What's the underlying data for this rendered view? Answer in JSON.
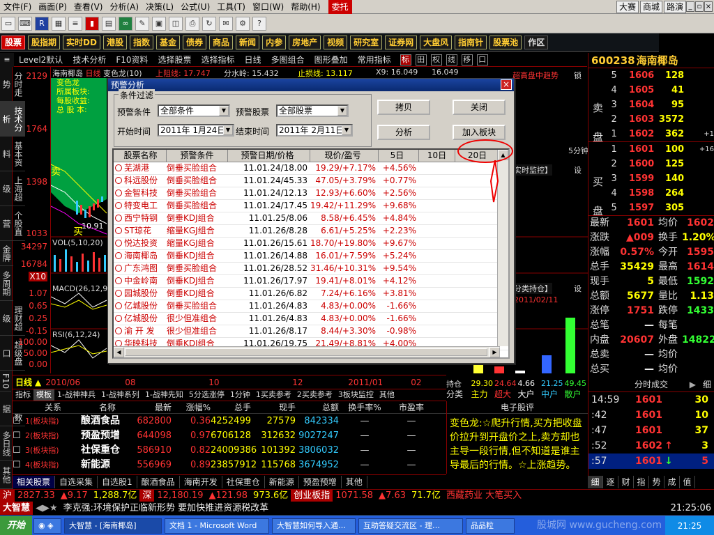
{
  "menubar": {
    "items": [
      "文件(F)",
      "画面(P)",
      "查看(V)",
      "分析(A)",
      "决策(L)",
      "公式(U)",
      "工具(T)",
      "窗口(W)",
      "帮助(H)"
    ],
    "trade": "委托",
    "right": [
      "大赛",
      "商城",
      "路演"
    ]
  },
  "tabs": [
    "股票",
    "股指期",
    "实时DD",
    "港股",
    "指数",
    "基金",
    "债券",
    "商品",
    "新闻",
    "内参",
    "房地产",
    "视频",
    "研究室",
    "证券网",
    "大盘风",
    "指南针",
    "股票池",
    "作区"
  ],
  "subbar": [
    "Level2默认",
    "技术分析",
    "F10资料",
    "选择股票",
    "选择指标",
    "日线",
    "多图组合",
    "图形叠加",
    "常用指标"
  ],
  "subbar_toggles": [
    "标",
    "田",
    "权",
    "线",
    "移",
    "口"
  ],
  "left_tabs": [
    "分时走势",
    "技术分析",
    "基本资料",
    "上海超级",
    "个股直营",
    "金牌",
    "多周期",
    "理财超级",
    "超级盘口",
    "F10",
    "主力数据",
    "多日线",
    "其他"
  ],
  "chart_header": {
    "stock": "海南椰岛",
    "period": "日线",
    "indicator": "变色龙(10)",
    "upper": "上阻线: 17.747",
    "mid": "分水岭: 15.432",
    "stop": "止损线: 13.117",
    "x9": "X9: 16.049",
    "x10": "16.049",
    "trend": "超高盘中趋势",
    "lock": "锁"
  },
  "chart_info": {
    "name": "变色龙",
    "sector_label": "所属板块:",
    "eps_label": "每股收益:",
    "share_label": "总 股 本:"
  },
  "price_axis": [
    "2129",
    "1764",
    "1398",
    "1033",
    "34297",
    "16784",
    "X10",
    "1.07",
    "0.65",
    "0.25",
    "-0.15",
    "100.00",
    "50.00",
    "0.00"
  ],
  "indicators": {
    "vol": "VOL(5,10,20)",
    "macd": "MACD(26,12,9)",
    "rsi": "RSI(6,12,24)"
  },
  "chart_labels": {
    "low": "10.91",
    "buy": "买",
    "sell": "卖",
    "realtime": "实时监控】",
    "set": "设",
    "classify": "分类持仓】",
    "set2": "设",
    "date": "2011/02/11",
    "fivemin": "5分钟"
  },
  "date_axis": {
    "label": "日线",
    "dates": [
      "2010/06",
      "08",
      "10",
      "12",
      "2011/01",
      "02"
    ]
  },
  "cap_bars": {
    "label_hold": "持仓",
    "label_cls": "分类",
    "values": [
      "29.30",
      "24.64",
      "4.66",
      "21.25",
      "49.45"
    ],
    "names": [
      "主力",
      "超大",
      "大户",
      "中户",
      "散户"
    ]
  },
  "quote": {
    "code": "600238",
    "name": "海南椰岛",
    "sell": [
      {
        "lv": "5",
        "p": "1606",
        "v": "128",
        "e": ""
      },
      {
        "lv": "4",
        "p": "1605",
        "v": "41",
        "e": ""
      },
      {
        "lv": "3",
        "p": "1604",
        "v": "95",
        "e": ""
      },
      {
        "lv": "2",
        "p": "1603",
        "v": "3572",
        "e": ""
      },
      {
        "lv": "1",
        "p": "1602",
        "v": "362",
        "e": "+1"
      }
    ],
    "buy": [
      {
        "lv": "1",
        "p": "1601",
        "v": "100",
        "e": "+16"
      },
      {
        "lv": "2",
        "p": "1600",
        "v": "125",
        "e": ""
      },
      {
        "lv": "3",
        "p": "1599",
        "v": "140",
        "e": ""
      },
      {
        "lv": "4",
        "p": "1598",
        "v": "264",
        "e": ""
      },
      {
        "lv": "5",
        "p": "1597",
        "v": "305",
        "e": ""
      }
    ],
    "sell_label": "卖盘",
    "buy_label": "买盘",
    "stats": [
      [
        "最新",
        "1601",
        "均价",
        "1602"
      ],
      [
        "涨跌",
        "▲009",
        "换手",
        "1.20%"
      ],
      [
        "涨幅",
        "0.57%",
        "今开",
        "1595"
      ],
      [
        "总手",
        "35429",
        "最高",
        "1614"
      ],
      [
        "现手",
        "5",
        "最低",
        "1592"
      ],
      [
        "总额",
        "5677",
        "量比",
        "1.13"
      ],
      [
        "涨停",
        "1751",
        "跌停",
        "1433"
      ],
      [
        "总笔",
        "—",
        "每笔",
        ""
      ],
      [
        "内盘",
        "20607",
        "外盘",
        "14822"
      ],
      [
        "总卖",
        "—",
        "均价",
        ""
      ],
      [
        "总买",
        "—",
        "均价",
        ""
      ]
    ]
  },
  "trades": {
    "title": "分时成交",
    "rows": [
      {
        "t": "14:59",
        "p": "1601",
        "a": "",
        "v": "30"
      },
      {
        "t": ":42",
        "p": "1601",
        "a": "",
        "v": "10"
      },
      {
        "t": ":47",
        "p": "1601",
        "a": "",
        "v": "37"
      },
      {
        "t": ":52",
        "p": "1602",
        "a": "↑",
        "v": "3"
      },
      {
        "t": ":57",
        "p": "1601",
        "a": "↓",
        "v": "5"
      }
    ]
  },
  "bottom_tabs": [
    "指标",
    "模板",
    "1-战神神兵",
    "1-战神系列",
    "1-战神先知",
    "5分选涨停",
    "1分钟",
    "1买卖参考",
    "2买卖参考",
    "3板块监控",
    "其他"
  ],
  "related": {
    "headers": [
      "关系",
      "名称",
      "最新",
      "涨幅%",
      "总手",
      "现手",
      "总额",
      "换手率%",
      "市盈率"
    ],
    "rows": [
      {
        "rel": "1(板块指)",
        "name": "酿酒食品",
        "last": "682800",
        "chg": "0.36",
        "vol": "4252499",
        "cur": "27579",
        "amt": "842334",
        "turn": "—",
        "pe": "—"
      },
      {
        "rel": "2(板块指)",
        "name": "预盈预增",
        "last": "644098",
        "chg": "0.97",
        "vol": "6706128",
        "cur": "312632",
        "amt": "9027247",
        "turn": "—",
        "pe": "—"
      },
      {
        "rel": "3(板块指)",
        "name": "社保重仓",
        "last": "586910",
        "chg": "0.82",
        "vol": "24009386",
        "cur": "101392",
        "amt": "3806032",
        "turn": "—",
        "pe": "—"
      },
      {
        "rel": "4(板块指)",
        "name": "新能源",
        "last": "556969",
        "chg": "0.89",
        "vol": "23857912",
        "cur": "115768",
        "amt": "3674952",
        "turn": "—",
        "pe": "—"
      }
    ]
  },
  "comment": {
    "title": "电子股评",
    "text": "变色龙:☆爬升行情,买方把收盘价拉升到开盘价之上,卖方却也主导一段行情,但不知道是谁主导最后的行情。☆上涨趋势。"
  },
  "bottom_groups": [
    "相关股票",
    "自选采集",
    "自选股1",
    "酿酒食品",
    "海南开发",
    "社保重仓",
    "新能源",
    "预盈预增",
    "其他"
  ],
  "quote_tabs": [
    "细",
    "逐",
    "财",
    "指",
    "势",
    "成",
    "值"
  ],
  "indexbar": {
    "sh_label": "沪",
    "sh": "2827.33",
    "sh_chg": "▲9.17",
    "sh_amt": "1,288.7亿",
    "sz_label": "深",
    "sz": "12,180.19",
    "sz_chg": "▲121.98",
    "sz_amt": "973.6亿",
    "cyb_label": "创业板指",
    "cyb": "1071.58",
    "cyb_chg": "▲7.63",
    "cyb_amt": "71.7亿",
    "news_tag": "西藏药业 大笔买入"
  },
  "newsbar": {
    "brand": "大智慧",
    "headline": "李克强:环境保护正临新形势 要加快推进资源税改革",
    "time": "21:25:06"
  },
  "taskbar": {
    "start": "开始",
    "tasks": [
      "大智慧 - [海南椰岛]",
      "文档 1 - Microsoft Word",
      "大智慧如何导入通…",
      "互助答疑交流区 - 理…",
      "品品粒"
    ],
    "clock": "21:25"
  },
  "dialog": {
    "title": "预警分析",
    "filter_legend": "条件过滤",
    "cond_label": "预警条件",
    "cond_value": "全部条件",
    "stock_label": "预警股票",
    "stock_value": "全部股票",
    "start_label": "开始时间",
    "start_value": "2011年 1月24日",
    "end_label": "结束时间",
    "end_value": "2011年 2月11日",
    "btn_copy": "拷贝",
    "btn_close": "关闭",
    "btn_analyze": "分析",
    "btn_add": "加入板块",
    "columns": [
      "股票名称",
      "预警条件",
      "预警日期/价格",
      "现价/盈亏",
      "5日",
      "10日",
      "20日"
    ],
    "rows": [
      [
        "芜湖港",
        "倒垂买脸组合",
        "11.01.24/18.00",
        "19.29/+7.17%",
        "+4.56%",
        "",
        ""
      ],
      [
        "科远股份",
        "倒垂买脸组合",
        "11.01.24/45.33",
        "47.05/+3.79%",
        "+0.77%",
        "",
        ""
      ],
      [
        "金智科技",
        "倒垂买脸组合",
        "11.01.24/12.13",
        "12.93/+6.60%",
        "+2.56%",
        "",
        ""
      ],
      [
        "特变电工",
        "倒垂买脸组合",
        "11.01.24/17.45",
        "19.42/+11.29%",
        "+9.68%",
        "",
        ""
      ],
      [
        "西宁特钢",
        "倒垂KDJ组合",
        "11.01.25/8.06",
        "8.58/+6.45%",
        "+4.84%",
        "",
        ""
      ],
      [
        "ST琼花",
        "缩量KGJ组合",
        "11.01.26/8.28",
        "6.61/+5.25%",
        "+2.23%",
        "",
        ""
      ],
      [
        "悦达投资",
        "缩量KGJ组合",
        "11.01.26/15.61",
        "18.70/+19.80%",
        "+9.67%",
        "",
        ""
      ],
      [
        "海南椰岛",
        "倒垂KDJ组合",
        "11.01.26/14.88",
        "16.01/+7.59%",
        "+5.24%",
        "",
        ""
      ],
      [
        "广东鸿图",
        "倒垂买脸组合",
        "11.01.26/28.52",
        "31.46/+10.31%",
        "+9.54%",
        "",
        ""
      ],
      [
        "中金岭南",
        "倒垂KDJ组合",
        "11.01.26/17.97",
        "19.41/+8.01%",
        "+4.12%",
        "",
        ""
      ],
      [
        "园城股份",
        "倒垂KDJ组合",
        "11.01.26/6.82",
        "7.24/+6.16%",
        "+3.81%",
        "",
        ""
      ],
      [
        "亿城股份",
        "倒垂买脸组合",
        "11.01.26/4.83",
        "4.83/+0.00%",
        "-1.66%",
        "",
        ""
      ],
      [
        "亿城股份",
        "很少但准组合",
        "11.01.26/4.83",
        "4.83/+0.00%",
        "-1.66%",
        "",
        ""
      ],
      [
        "渝 开 发",
        "很少但准组合",
        "11.01.26/8.17",
        "8.44/+3.30%",
        "-0.98%",
        "",
        ""
      ],
      [
        "华映科技",
        "倒垂KDJ组合",
        "11.01.26/19.75",
        "21.49/+8.81%",
        "+4.00%",
        "",
        ""
      ]
    ]
  },
  "watermark": "股城网 www.gucheng.com"
}
